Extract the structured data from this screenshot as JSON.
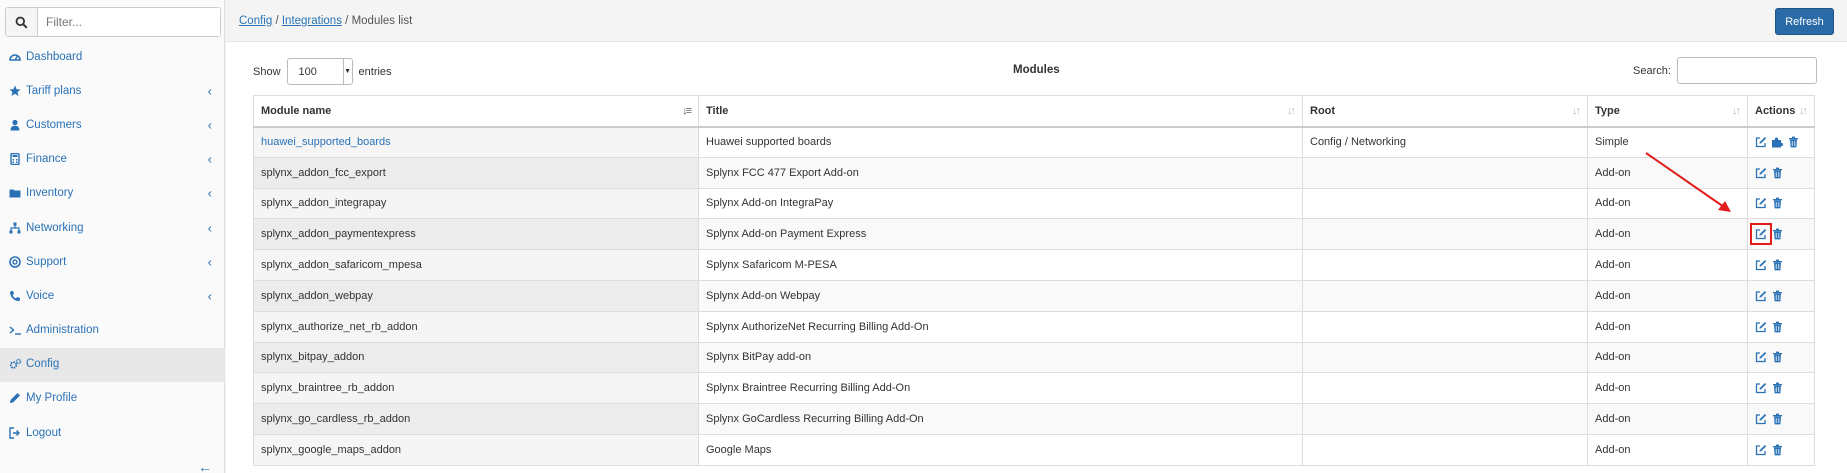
{
  "sidebar": {
    "filter_placeholder": "Filter...",
    "items": [
      {
        "label": "Dashboard",
        "icon": "dashboard-icon",
        "has_children": false,
        "active": false
      },
      {
        "label": "Tariff plans",
        "icon": "star-icon",
        "has_children": true,
        "active": false
      },
      {
        "label": "Customers",
        "icon": "user-icon",
        "has_children": true,
        "active": false
      },
      {
        "label": "Finance",
        "icon": "calculator-icon",
        "has_children": true,
        "active": false
      },
      {
        "label": "Inventory",
        "icon": "folder-icon",
        "has_children": true,
        "active": false
      },
      {
        "label": "Networking",
        "icon": "sitemap-icon",
        "has_children": true,
        "active": false
      },
      {
        "label": "Support",
        "icon": "lifebuoy-icon",
        "has_children": true,
        "active": false
      },
      {
        "label": "Voice",
        "icon": "phone-icon",
        "has_children": true,
        "active": false
      },
      {
        "label": "Administration",
        "icon": "terminal-icon",
        "has_children": false,
        "active": false
      },
      {
        "label": "Config",
        "icon": "cogs-icon",
        "has_children": false,
        "active": true
      },
      {
        "label": "My Profile",
        "icon": "pencil-icon",
        "has_children": false,
        "active": false
      },
      {
        "label": "Logout",
        "icon": "sign-out-icon",
        "has_children": false,
        "active": false
      }
    ],
    "collapse_icon": "arrow-left-icon"
  },
  "header": {
    "breadcrumb": [
      {
        "label": "Config",
        "link": true
      },
      {
        "label": "Integrations",
        "link": true
      },
      {
        "label": "Modules list",
        "link": false
      }
    ],
    "separator": "/",
    "refresh_label": "Refresh"
  },
  "table_controls": {
    "show_label": "Show",
    "entries_value": "100",
    "entries_label": "entries",
    "title": "Modules",
    "search_label": "Search:",
    "search_value": ""
  },
  "table": {
    "columns": [
      "Module name",
      "Title",
      "Root",
      "Type",
      "Actions"
    ],
    "rows": [
      {
        "name": "huawei_supported_boards",
        "title": "Huawei supported boards",
        "root": "Config / Networking",
        "type": "Simple",
        "is_link": true,
        "actions": [
          "edit-icon",
          "puzzle-icon",
          "trash-icon"
        ]
      },
      {
        "name": "splynx_addon_fcc_export",
        "title": "Splynx FCC 477 Export Add-on",
        "root": "",
        "type": "Add-on",
        "is_link": false,
        "actions": [
          "edit-icon",
          "trash-icon"
        ]
      },
      {
        "name": "splynx_addon_integrapay",
        "title": "Splynx Add-on IntegraPay",
        "root": "",
        "type": "Add-on",
        "is_link": false,
        "actions": [
          "edit-icon",
          "trash-icon"
        ]
      },
      {
        "name": "splynx_addon_paymentexpress",
        "title": "Splynx Add-on Payment Express",
        "root": "",
        "type": "Add-on",
        "is_link": false,
        "actions": [
          "edit-icon",
          "trash-icon"
        ],
        "highlight": true
      },
      {
        "name": "splynx_addon_safaricom_mpesa",
        "title": "Splynx Safaricom M-PESA",
        "root": "",
        "type": "Add-on",
        "is_link": false,
        "actions": [
          "edit-icon",
          "trash-icon"
        ]
      },
      {
        "name": "splynx_addon_webpay",
        "title": "Splynx Add-on Webpay",
        "root": "",
        "type": "Add-on",
        "is_link": false,
        "actions": [
          "edit-icon",
          "trash-icon"
        ]
      },
      {
        "name": "splynx_authorize_net_rb_addon",
        "title": "Splynx AuthorizeNet Recurring Billing Add-On",
        "root": "",
        "type": "Add-on",
        "is_link": false,
        "actions": [
          "edit-icon",
          "trash-icon"
        ]
      },
      {
        "name": "splynx_bitpay_addon",
        "title": "Splynx BitPay add-on",
        "root": "",
        "type": "Add-on",
        "is_link": false,
        "actions": [
          "edit-icon",
          "trash-icon"
        ]
      },
      {
        "name": "splynx_braintree_rb_addon",
        "title": "Splynx Braintree Recurring Billing Add-On",
        "root": "",
        "type": "Add-on",
        "is_link": false,
        "actions": [
          "edit-icon",
          "trash-icon"
        ]
      },
      {
        "name": "splynx_go_cardless_rb_addon",
        "title": "Splynx GoCardless Recurring Billing Add-On",
        "root": "",
        "type": "Add-on",
        "is_link": false,
        "actions": [
          "edit-icon",
          "trash-icon"
        ]
      },
      {
        "name": "splynx_google_maps_addon",
        "title": "Google Maps",
        "root": "",
        "type": "Add-on",
        "is_link": false,
        "actions": [
          "edit-icon",
          "trash-icon"
        ]
      }
    ]
  },
  "colors": {
    "accent": "#2a72b5",
    "button": "#2a6aa6",
    "annotation": "#e21b1b"
  }
}
